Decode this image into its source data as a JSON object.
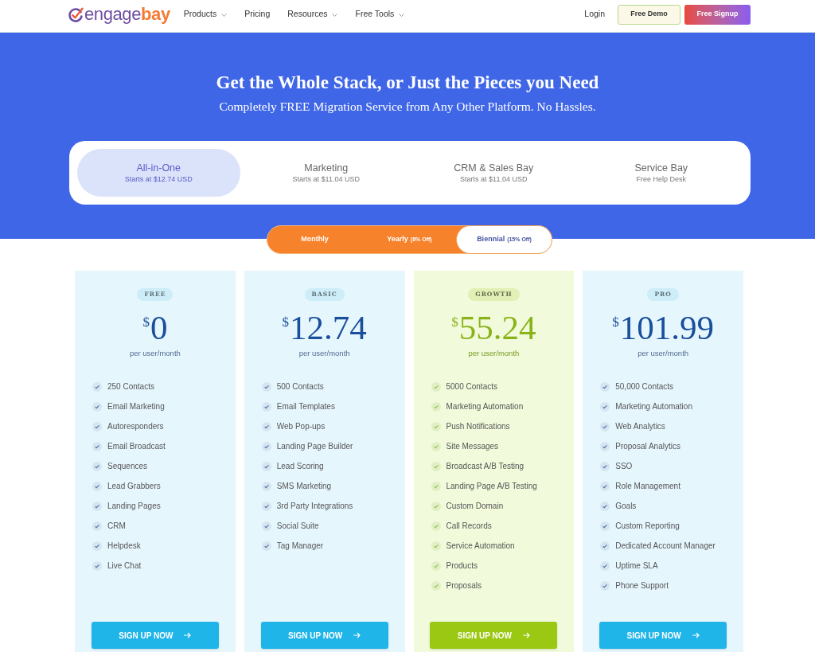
{
  "nav": {
    "logo": {
      "name_start": "engage",
      "name_end": "bay"
    },
    "menu": [
      {
        "label": "Products",
        "dropdown": true
      },
      {
        "label": "Pricing",
        "dropdown": false
      },
      {
        "label": "Resources",
        "dropdown": true
      },
      {
        "label": "Free Tools",
        "dropdown": true
      }
    ],
    "login": "Login",
    "demo_button": "Free Demo",
    "signup_button": "Free Signup"
  },
  "hero": {
    "title": "Get the Whole Stack, or Just the Pieces you Need",
    "subtitle": "Completely FREE Migration Service from Any Other Platform. No Hassles."
  },
  "product_tabs": [
    {
      "title": "All-in-One",
      "subtitle": "Starts at $12.74 USD",
      "selected": true
    },
    {
      "title": "Marketing",
      "subtitle": "Starts at $11.04 USD",
      "selected": false
    },
    {
      "title": "CRM & Sales Bay",
      "subtitle": "Starts at $11.04 USD",
      "selected": false
    },
    {
      "title": "Service Bay",
      "subtitle": "Free Help Desk",
      "selected": false
    }
  ],
  "billing_options": [
    {
      "label": "Monthly",
      "selected": false
    },
    {
      "label": "Yearly",
      "note": "(8% Off)",
      "selected": false
    },
    {
      "label": "Biennial",
      "note": "(15% Off)",
      "selected": true
    }
  ],
  "plans": [
    {
      "badge": "FREE",
      "currency": "$",
      "price": "0",
      "period": "per user/month",
      "highlighted": false,
      "features": [
        "250 Contacts",
        "Email Marketing",
        "Autoresponders",
        "Email Broadcast",
        "Sequences",
        "Lead Grabbers",
        "Landing Pages",
        "CRM",
        "Helpdesk",
        "Live Chat"
      ],
      "button": "SIGN UP NOW"
    },
    {
      "badge": "BASIC",
      "currency": "$",
      "price": "12.74",
      "period": "per user/month",
      "highlighted": false,
      "features": [
        "500 Contacts",
        "Email Templates",
        "Web Pop-ups",
        "Landing Page Builder",
        "Lead Scoring",
        "SMS Marketing",
        "3rd Party Integrations",
        "Social Suite",
        "Tag Manager"
      ],
      "button": "SIGN UP NOW"
    },
    {
      "badge": "GROWTH",
      "currency": "$",
      "price": "55.24",
      "period": "per user/month",
      "highlighted": true,
      "features": [
        "5000 Contacts",
        "Marketing Automation",
        "Push Notifications",
        "Site Messages",
        "Broadcast A/B Testing",
        "Landing Page A/B Testing",
        "Custom Domain",
        "Call Records",
        "Service Automation",
        "Products",
        "Proposals"
      ],
      "button": "SIGN UP NOW"
    },
    {
      "badge": "PRO",
      "currency": "$",
      "price": "101.99",
      "period": "per user/month",
      "highlighted": false,
      "features": [
        "50,000 Contacts",
        "Marketing Automation",
        "Web Analytics",
        "Proposal Analytics",
        "SSO",
        "Role Management",
        "Goals",
        "Custom Reporting",
        "Dedicated Account Manager",
        "Uptime SLA",
        "Phone Support"
      ],
      "button": "SIGN UP NOW"
    }
  ]
}
